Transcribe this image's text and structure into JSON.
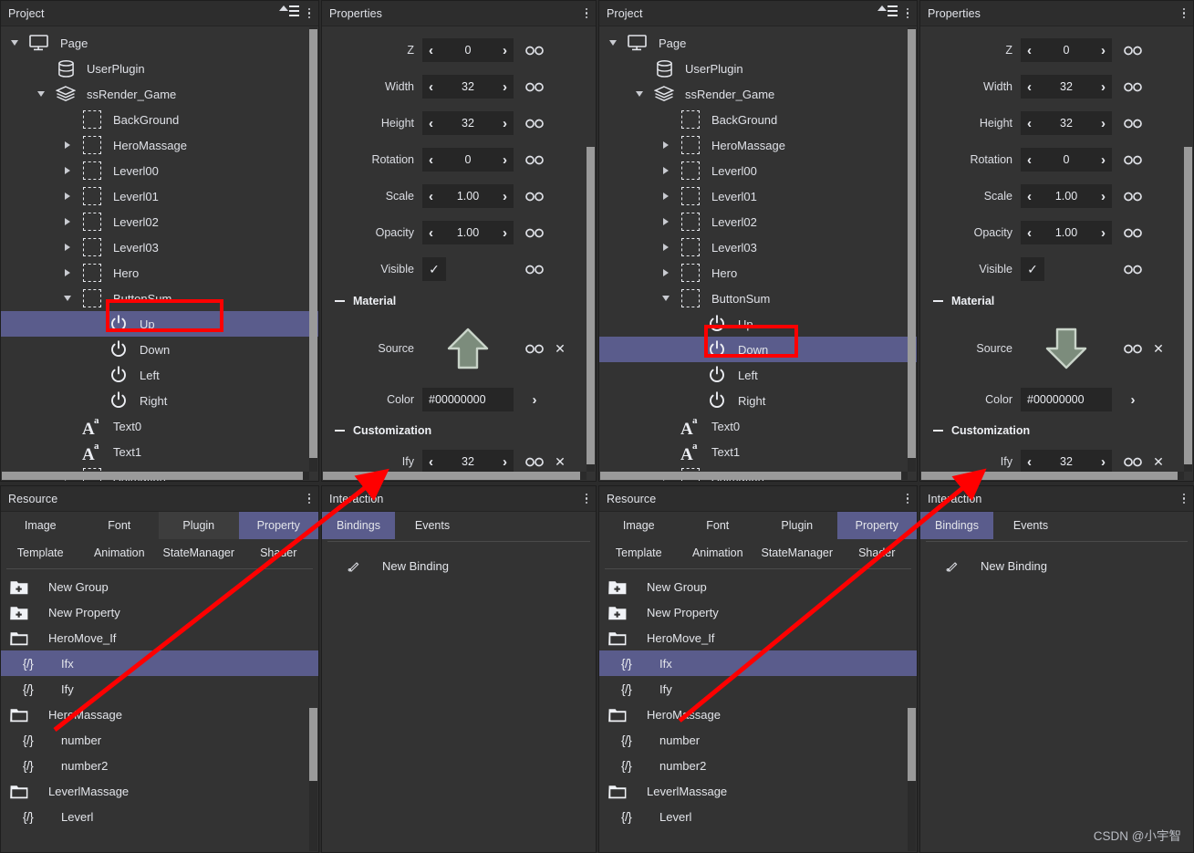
{
  "panels": {
    "project_title": "Project",
    "properties_title": "Properties",
    "resource_title": "Resource",
    "interaction_title": "Interaction"
  },
  "tree": {
    "nodes": [
      {
        "label": "Page",
        "indent": 0,
        "twisty": "down",
        "icon": "monitor-icon"
      },
      {
        "label": "UserPlugin",
        "indent": 1,
        "twisty": "none",
        "icon": "database-icon"
      },
      {
        "label": "ssRender_Game",
        "indent": 1,
        "twisty": "down",
        "icon": "layers-icon"
      },
      {
        "label": "BackGround",
        "indent": 2,
        "twisty": "none",
        "icon": "dashed-box-icon"
      },
      {
        "label": "HeroMassage",
        "indent": 2,
        "twisty": "right",
        "icon": "dashed-box-icon"
      },
      {
        "label": "Leverl00",
        "indent": 2,
        "twisty": "right",
        "icon": "dashed-box-icon"
      },
      {
        "label": "Leverl01",
        "indent": 2,
        "twisty": "right",
        "icon": "dashed-box-icon"
      },
      {
        "label": "Leverl02",
        "indent": 2,
        "twisty": "right",
        "icon": "dashed-box-icon"
      },
      {
        "label": "Leverl03",
        "indent": 2,
        "twisty": "right",
        "icon": "dashed-box-icon"
      },
      {
        "label": "Hero",
        "indent": 2,
        "twisty": "right",
        "icon": "dashed-box-icon"
      },
      {
        "label": "ButtonSum",
        "indent": 2,
        "twisty": "down",
        "icon": "dashed-box-icon"
      },
      {
        "label": "Up",
        "indent": 3,
        "twisty": "none",
        "icon": "power-icon"
      },
      {
        "label": "Down",
        "indent": 3,
        "twisty": "none",
        "icon": "power-icon"
      },
      {
        "label": "Left",
        "indent": 3,
        "twisty": "none",
        "icon": "power-icon"
      },
      {
        "label": "Right",
        "indent": 3,
        "twisty": "none",
        "icon": "power-icon"
      },
      {
        "label": "Text0",
        "indent": 2,
        "twisty": "none",
        "icon": "text-icon"
      },
      {
        "label": "Text1",
        "indent": 2,
        "twisty": "none",
        "icon": "text-icon"
      },
      {
        "label": "Animation",
        "indent": 2,
        "twisty": "right",
        "icon": "dashed-box-icon"
      }
    ],
    "selected_left": "Up",
    "selected_right": "Down"
  },
  "properties": {
    "rows": [
      {
        "label": "Z",
        "value": "0"
      },
      {
        "label": "Width",
        "value": "32"
      },
      {
        "label": "Height",
        "value": "32"
      },
      {
        "label": "Rotation",
        "value": "0"
      },
      {
        "label": "Scale",
        "value": "1.00"
      },
      {
        "label": "Opacity",
        "value": "1.00"
      }
    ],
    "visible_label": "Visible",
    "visible_checked": "✓",
    "material_section": "Material",
    "source_label": "Source",
    "source_left_icon": "arrow-up-icon",
    "source_right_icon": "arrow-down-icon",
    "color_label": "Color",
    "color_value": "#00000000",
    "customization_section": "Customization",
    "ify_label": "Ify",
    "ify_value": "32",
    "prev_chevron": "‹",
    "next_chevron": "›",
    "close_glyph": "✕"
  },
  "resource": {
    "tabs_row1": [
      "Image",
      "Font",
      "Plugin",
      "Property"
    ],
    "tabs_row2": [
      "Template",
      "Animation",
      "StateManager",
      "Shader"
    ],
    "selected_tab": "Property",
    "hover_tab_left": "Plugin",
    "items": [
      {
        "label": "New Group",
        "icon": "folder-plus-icon",
        "indent": 0
      },
      {
        "label": "New Property",
        "icon": "folder-plus-icon",
        "indent": 0
      },
      {
        "label": "HeroMove_If",
        "icon": "folder-icon",
        "indent": 0
      },
      {
        "label": "Ifx",
        "icon": "code-brace-icon",
        "indent": 1
      },
      {
        "label": "Ify",
        "icon": "code-brace-icon",
        "indent": 1
      },
      {
        "label": "HeroMassage",
        "icon": "folder-icon",
        "indent": 0
      },
      {
        "label": "number",
        "icon": "code-brace-icon",
        "indent": 1
      },
      {
        "label": "number2",
        "icon": "code-brace-icon",
        "indent": 1
      },
      {
        "label": "LeverlMassage",
        "icon": "folder-icon",
        "indent": 0
      },
      {
        "label": "Leverl",
        "icon": "code-brace-icon",
        "indent": 1
      }
    ],
    "selected_item": "Ifx"
  },
  "interaction": {
    "tabs": [
      "Bindings",
      "Events"
    ],
    "selected_tab": "Bindings",
    "new_binding_label": "New Binding",
    "new_binding_icon": "pen-icon"
  },
  "annotations": {
    "watermark": "CSDN @小宇智",
    "highlight_color": "#ff0000",
    "selection_color": "#5a5c8c"
  }
}
